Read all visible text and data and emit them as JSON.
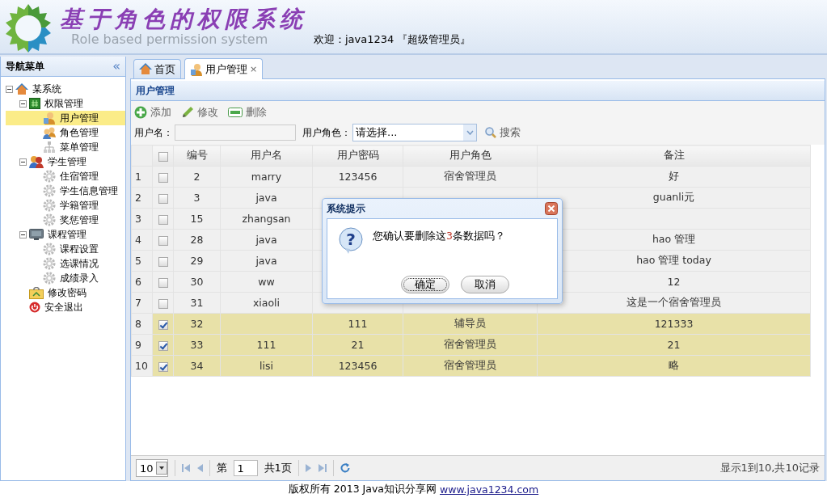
{
  "header": {
    "title": "基于角色的权限系统",
    "subtitle": "Role based permission system",
    "welcome": "欢迎：java1234 『超级管理员』"
  },
  "sidebar": {
    "title": "导航菜单",
    "collapse": "«",
    "tree": [
      {
        "label": "某系统",
        "kind": "home",
        "expanded": true,
        "selected": false,
        "children": [
          {
            "label": "权限管理",
            "kind": "folder",
            "expanded": true,
            "selected": false,
            "children": [
              {
                "label": "用户管理",
                "kind": "user",
                "selected": true
              },
              {
                "label": "角色管理",
                "kind": "users",
                "selected": false
              },
              {
                "label": "菜单管理",
                "kind": "sitemap",
                "selected": false
              }
            ]
          },
          {
            "label": "学生管理",
            "kind": "people",
            "expanded": true,
            "selected": false,
            "children": [
              {
                "label": "住宿管理",
                "kind": "gear",
                "selected": false
              },
              {
                "label": "学生信息管理",
                "kind": "gear",
                "selected": false
              },
              {
                "label": "学籍管理",
                "kind": "gear",
                "selected": false
              },
              {
                "label": "奖惩管理",
                "kind": "gear",
                "selected": false
              }
            ]
          },
          {
            "label": "课程管理",
            "kind": "monitor",
            "expanded": true,
            "selected": false,
            "children": [
              {
                "label": "课程设置",
                "kind": "gear",
                "selected": false
              },
              {
                "label": "选课情况",
                "kind": "gear",
                "selected": false
              },
              {
                "label": "成绩录入",
                "kind": "gear",
                "selected": false
              }
            ]
          },
          {
            "label": "修改密码",
            "kind": "key",
            "selected": false
          },
          {
            "label": "安全退出",
            "kind": "exit",
            "selected": false
          }
        ]
      }
    ]
  },
  "tabs": [
    {
      "label": "首页",
      "kind": "home",
      "selected": false
    },
    {
      "label": "用户管理",
      "kind": "user",
      "selected": true,
      "close": "×"
    }
  ],
  "panel": {
    "title": "用户管理",
    "toolbar": [
      {
        "label": "添加",
        "kind": "add"
      },
      {
        "label": "修改",
        "kind": "edit"
      },
      {
        "label": "删除",
        "kind": "remove"
      }
    ],
    "search": {
      "name_label": "用户名：",
      "role_label": "用户角色：",
      "role_value": "请选择...",
      "button": "搜索"
    },
    "table": {
      "columns": [
        "编号",
        "用户名",
        "用户密码",
        "用户角色",
        "备注"
      ],
      "all_checked": false,
      "rows": [
        {
          "n": "1",
          "checked": false,
          "id": "2",
          "name": "marry",
          "password": "123456",
          "role": "宿舍管理员",
          "remark": "好"
        },
        {
          "n": "2",
          "checked": false,
          "id": "3",
          "name": "java",
          "remark": "guanli元"
        },
        {
          "n": "3",
          "checked": false,
          "id": "15",
          "name": "zhangsan"
        },
        {
          "n": "4",
          "checked": false,
          "id": "28",
          "name": "java",
          "remark": "hao 管理"
        },
        {
          "n": "5",
          "checked": false,
          "id": "29",
          "name": "java",
          "remark": "hao 管理 today"
        },
        {
          "n": "6",
          "checked": false,
          "id": "30",
          "name": "ww",
          "remark": "12"
        },
        {
          "n": "7",
          "checked": false,
          "id": "31",
          "name": "xiaoli",
          "remark": "这是一个宿舍管理员"
        },
        {
          "n": "8",
          "checked": true,
          "id": "32",
          "password": "111",
          "role": "辅导员",
          "remark": "121333"
        },
        {
          "n": "9",
          "checked": true,
          "id": "33",
          "name": "111",
          "password": "21",
          "role": "宿舍管理员",
          "remark": "21"
        },
        {
          "n": "10",
          "checked": true,
          "id": "34",
          "name": "lisi",
          "password": "123456",
          "role": "宿舍管理员",
          "remark": "略"
        }
      ]
    },
    "pager": {
      "page_size": "10",
      "page_prefix": "第",
      "page": "1",
      "page_suffix": "共1页",
      "summary": "显示1到10,共10记录"
    }
  },
  "dialog": {
    "title": "系统提示",
    "icon": "?",
    "message": [
      {
        "text": "您确认要删除这",
        "kind": "plain"
      },
      {
        "text": "3",
        "kind": "emphasis"
      },
      {
        "text": "条数据吗？",
        "kind": "plain"
      }
    ],
    "buttons": [
      "确定",
      "取消"
    ]
  },
  "footer": {
    "text": "版权所有 2013 Java知识分享网",
    "link": "www.java1234.com"
  }
}
